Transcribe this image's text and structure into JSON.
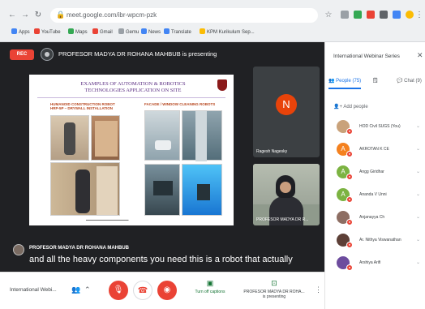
{
  "browser": {
    "url": "meet.google.com/ibr-wpcm-pzk",
    "bookmarks": [
      "Apps",
      "YouTube",
      "Maps",
      "Gmail",
      "Gemu",
      "News",
      "Translate",
      "KPM Kurikulum Sep..."
    ],
    "colors": {
      "red": "#ea4335",
      "green": "#34a853",
      "blue": "#4285f4",
      "yellow": "#fbbc04"
    }
  },
  "meet": {
    "rec_label": "REC",
    "presenting_text": "PROFESOR MADYA DR ROHANA MAHBUB is presenting",
    "slide": {
      "title_line1": "EXAMPLES OF AUTOMATION & ROBOTICS",
      "title_line2": "TECHNOLOGIES APPLICATION ON SITE",
      "caption_left_1": "HUMANOID CONSTRUCTION ROBOT",
      "caption_left_2": "HRP-5P – DRYWALL INSTALLATION",
      "caption_right": "FACADE / WINDOW CLEANING ROBOTS"
    },
    "tiles": [
      {
        "initial": "N",
        "name": "Ragesh Nagesky"
      },
      {
        "name": "PROFESOR MADYA DR R..."
      }
    ],
    "captions": {
      "speaker": "PROFESOR MADYA DR ROHANA MAHBUB",
      "text": "and all the heavy components you need this is a robot that actually"
    },
    "bottom": {
      "meeting_name": "International Webi...",
      "turn_off_captions": "Turn off captions",
      "presenter_line1": "PROFESOR MADYA DR ROHA...",
      "presenter_line2": "is presenting"
    }
  },
  "panel": {
    "title": "International Webinar Series",
    "close_icon": "close-icon",
    "tab_people": "People (75)",
    "tab_chat": "Chat (9)",
    "add_people": "Add people",
    "participants": [
      {
        "name": "HOD Civil SUGS (You)",
        "initial": "",
        "color": "#c9a27a"
      },
      {
        "name": "AKROTAN K CE",
        "initial": "A",
        "color": "#f4811f"
      },
      {
        "name": "Angg Giridhar",
        "initial": "A",
        "color": "#7cb342"
      },
      {
        "name": "Ananda V Unni",
        "initial": "A",
        "color": "#7cb342"
      },
      {
        "name": "Anjanayya Ch",
        "initial": "",
        "color": "#8d6e63"
      },
      {
        "name": "Ar. Nithya Viswanathan",
        "initial": "",
        "color": "#5d4037"
      },
      {
        "name": "Arshiya Arifi",
        "initial": "",
        "color": "#6d4c9e"
      }
    ]
  }
}
